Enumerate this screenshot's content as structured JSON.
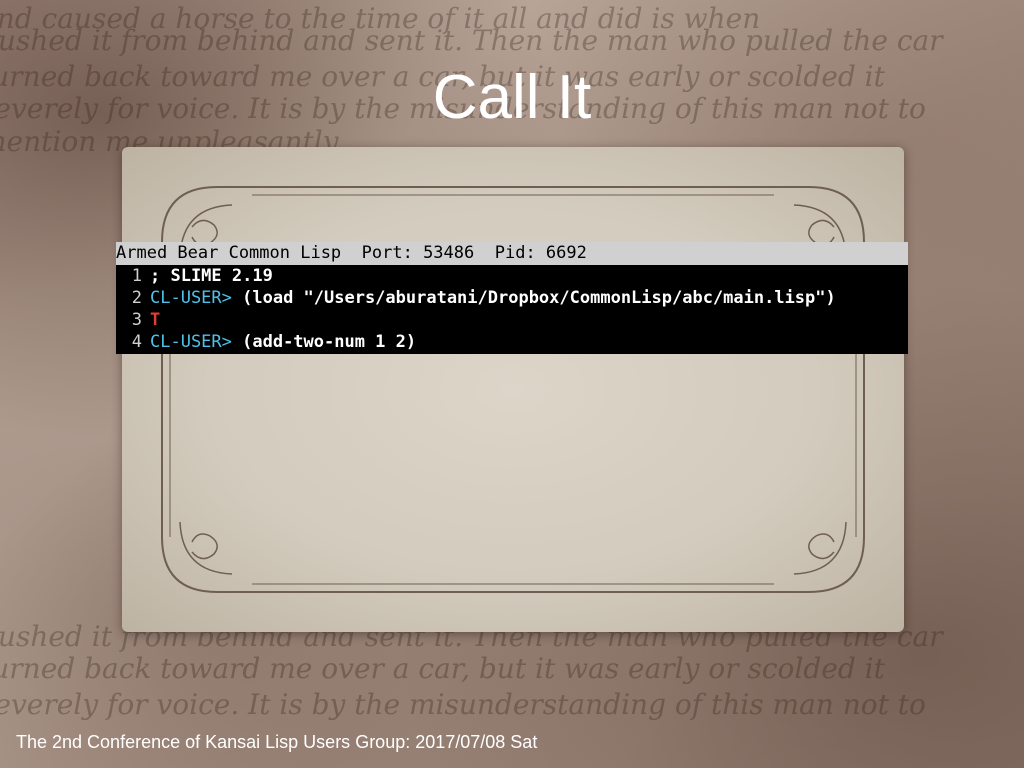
{
  "slide": {
    "title": "Call It",
    "footer": "The 2nd Conference of Kansai Lisp Users Group: 2017/07/08 Sat"
  },
  "terminal": {
    "header": {
      "app": "Armed Bear Common Lisp",
      "port": "Port: 53486",
      "pid": "Pid: 6692"
    },
    "lines": [
      {
        "num": "1",
        "prompt": "",
        "text": "; SLIME 2.19"
      },
      {
        "num": "2",
        "prompt": "CL-USER>",
        "text": " (load \"/Users/aburatani/Dropbox/CommonLisp/abc/main.lisp\")"
      },
      {
        "num": "3",
        "prompt": "",
        "text": "T"
      },
      {
        "num": "4",
        "prompt": "CL-USER>",
        "text": " (add-two-num 1 2)"
      }
    ]
  },
  "colors": {
    "prompt": "#4fc1e9",
    "result": "#e04030",
    "terminal_bg": "#000000",
    "header_bg": "#d0d0d0"
  }
}
